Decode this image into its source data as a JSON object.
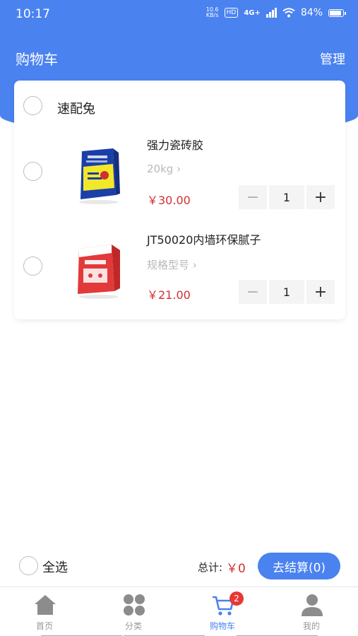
{
  "status": {
    "time": "10:17",
    "speed_value": "10.6",
    "speed_unit": "KB/s",
    "hd": "HD",
    "network": "4G+",
    "battery": "84%"
  },
  "header": {
    "title": "购物车",
    "manage_label": "管理"
  },
  "shop": {
    "name": "速配兔"
  },
  "products": [
    {
      "name": "强力瓷砖胶",
      "spec": "20kg",
      "price": "￥30.00",
      "quantity": "1"
    },
    {
      "name": "JT50020内墙环保腻子",
      "spec": "规格型号",
      "price": "￥21.00",
      "quantity": "1"
    }
  ],
  "bottom": {
    "select_all": "全选",
    "total_label": "总计:",
    "total_value": "￥0",
    "checkout": "去结算(0)"
  },
  "tabs": [
    {
      "label": "首页",
      "icon": "home-icon"
    },
    {
      "label": "分类",
      "icon": "category-icon"
    },
    {
      "label": "购物车",
      "icon": "cart-icon",
      "badge": "2"
    },
    {
      "label": "我的",
      "icon": "user-icon"
    }
  ],
  "colors": {
    "accent": "#4a82f0",
    "price": "#d32f2f",
    "badge": "#e53935"
  }
}
